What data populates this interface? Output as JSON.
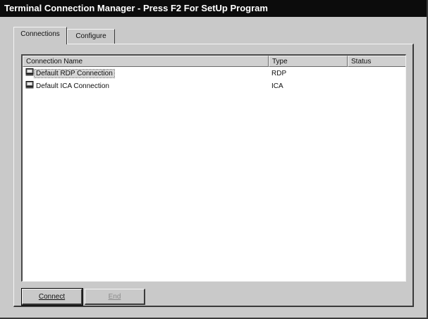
{
  "window": {
    "title": "Terminal Connection Manager - Press F2 For SetUp Program"
  },
  "tabs": [
    {
      "label": "Connections",
      "active": true
    },
    {
      "label": "Configure",
      "active": false
    }
  ],
  "list": {
    "columns": [
      "Connection Name",
      "Type",
      "Status"
    ],
    "rows": [
      {
        "name": "Default RDP Connection",
        "type": "RDP",
        "status": "",
        "icon": "computer-icon",
        "selected": true
      },
      {
        "name": "Default ICA Connection",
        "type": "ICA",
        "status": "",
        "icon": "computer-icon",
        "selected": false
      }
    ]
  },
  "buttons": {
    "connect": "Connect",
    "end": "End"
  },
  "colors": {
    "titlebar": "#0c0c0c",
    "face": "#c9c9c9",
    "list_bg": "#ffffff"
  }
}
